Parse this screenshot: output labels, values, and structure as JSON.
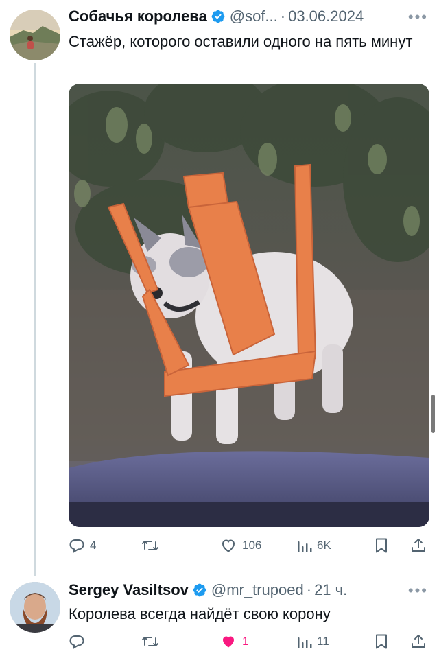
{
  "tweets": [
    {
      "author_name": "Собачья королева",
      "handle": "@sof...",
      "separator": "·",
      "timestamp": "03.06.2024",
      "text": "Стажёр, которого оставили одного на пять минут",
      "actions": {
        "replies": "4",
        "retweets": "",
        "likes": "106",
        "views": "6K"
      }
    },
    {
      "author_name": "Sergey Vasiltsov",
      "handle": "@mr_trupoed",
      "separator": "·",
      "timestamp": "21 ч.",
      "text": "Королева всегда найдёт свою корону",
      "actions": {
        "replies": "",
        "retweets": "",
        "likes": "1",
        "views": "11"
      }
    }
  ],
  "colors": {
    "verified_badge": "#1d9bf0",
    "liked_heart": "#f91880",
    "secondary_text": "#536471",
    "thread_line": "#cfd9de"
  },
  "icons": [
    "reply-icon",
    "retweet-icon",
    "like-icon",
    "views-icon",
    "bookmark-icon",
    "share-icon",
    "verified-icon",
    "more-icon"
  ]
}
